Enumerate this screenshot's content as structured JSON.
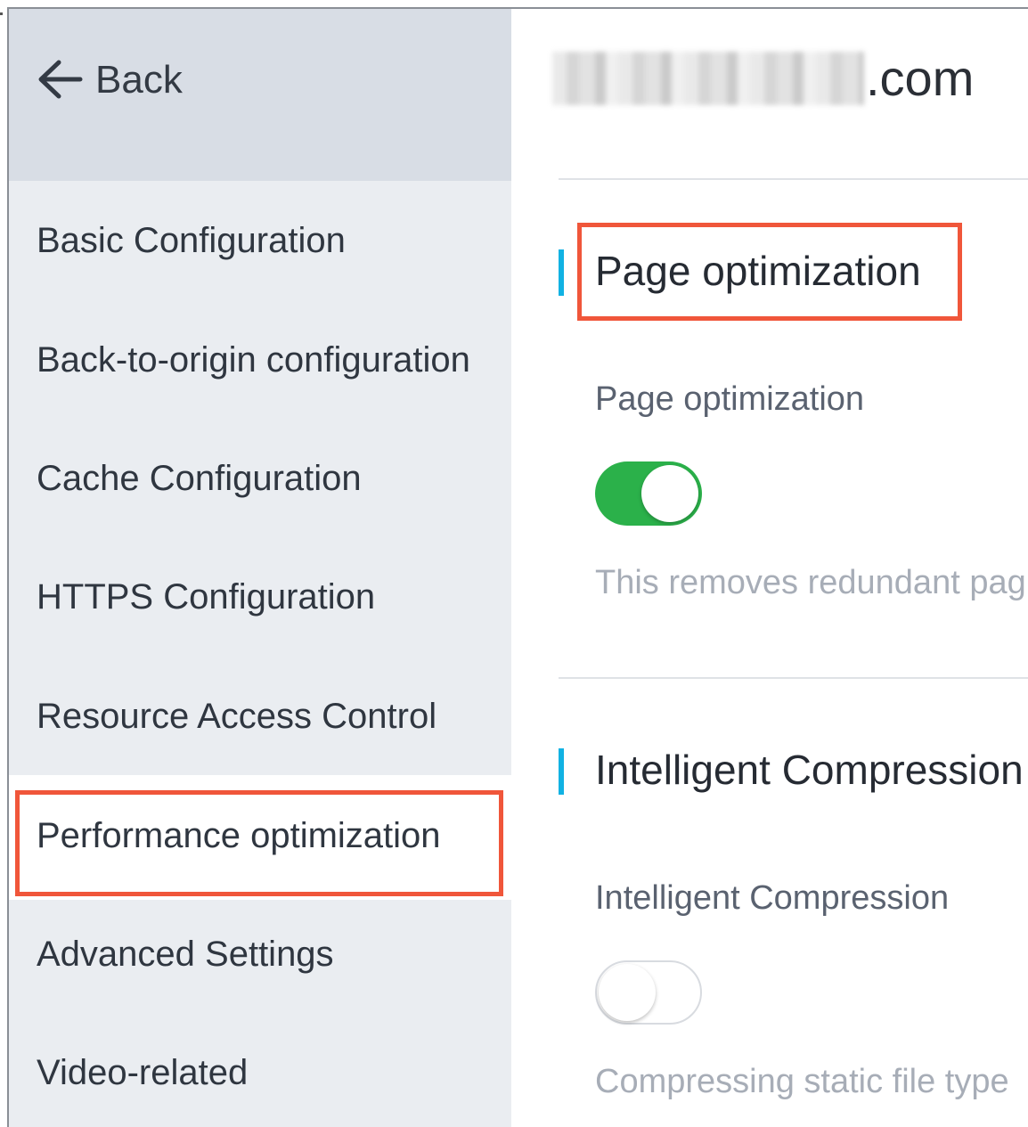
{
  "sidebar": {
    "back_label": "Back",
    "items": [
      {
        "label": "Basic Configuration"
      },
      {
        "label": "Back-to-origin configuration"
      },
      {
        "label": "Cache Configuration"
      },
      {
        "label": "HTTPS Configuration"
      },
      {
        "label": "Resource Access Control"
      },
      {
        "label": "Performance optimization"
      },
      {
        "label": "Advanced Settings"
      },
      {
        "label": "Video-related"
      }
    ],
    "active_item": "Performance optimization"
  },
  "header": {
    "domain_suffix": ".com"
  },
  "sections": [
    {
      "title": "Page optimization",
      "field_label": "Page optimization",
      "toggle_on": true,
      "description": "This removes redundant pag"
    },
    {
      "title": "Intelligent Compression",
      "field_label": "Intelligent Compression",
      "toggle_on": false,
      "description": "Compressing static file type"
    }
  ],
  "colors": {
    "accent_bar": "#11b2e3",
    "toggle_on": "#2bb14a",
    "highlight": "#f0563a",
    "sidebar_bg": "#eaedf1",
    "back_bg": "#d8dde5"
  }
}
